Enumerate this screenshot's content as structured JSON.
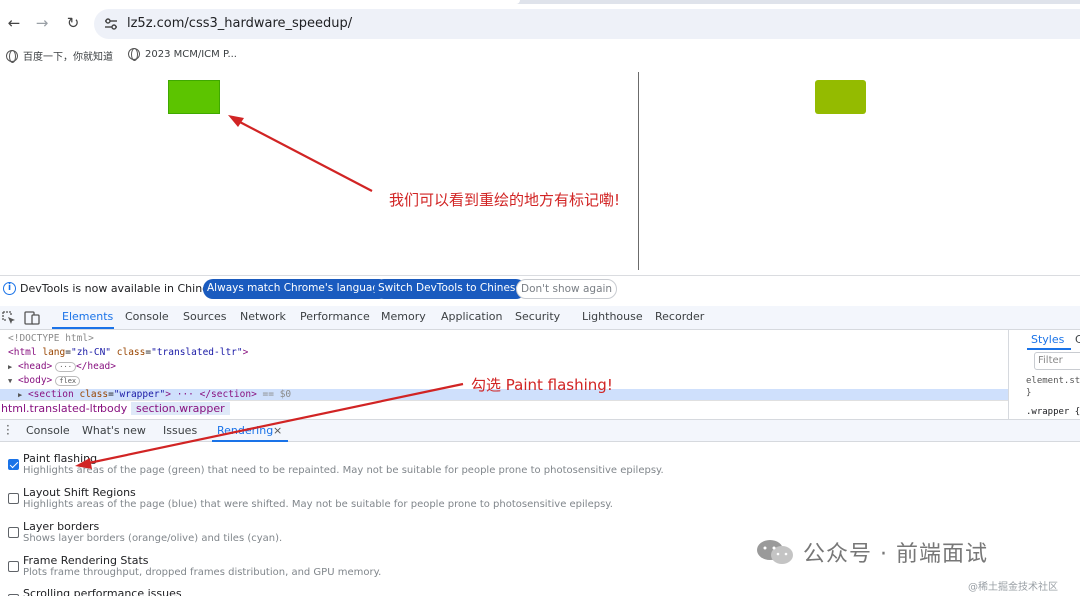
{
  "browser": {
    "url": "lz5z.com/css3_hardware_speedup/",
    "bookmarks": [
      "百度一下，你就知道",
      "2023 MCM/ICM P..."
    ]
  },
  "page": {
    "annotation_main": "我们可以看到重绘的地方有标记嘞!",
    "annotation_paint": "勾选 Paint flashing!"
  },
  "infobar": {
    "message": "DevTools is now available in Chinese!",
    "btn_match": "Always match Chrome's language",
    "btn_switch": "Switch DevTools to Chinese",
    "btn_dismiss": "Don't show again",
    "info_icon": "i"
  },
  "devtools": {
    "tabs": [
      "Elements",
      "Console",
      "Sources",
      "Network",
      "Performance",
      "Memory",
      "Application",
      "Security",
      "Lighthouse",
      "Recorder"
    ],
    "dom": {
      "doctype": "<!DOCTYPE html>",
      "html_open": "<html",
      "html_lang_attr": "lang",
      "html_lang_val": "\"zh-CN\"",
      "html_class_attr": "class",
      "html_class_val": "\"translated-ltr\"",
      "html_close": ">",
      "head": "<head>",
      "head_ellipsis": "···",
      "head_end": "</head>",
      "body": "<body>",
      "body_badge": "flex",
      "section_open": "<section",
      "section_attr": "class",
      "section_val": "\"wrapper\"",
      "section_rest": "> ··· </section>",
      "section_ref": "== $0"
    },
    "breadcrumbs": [
      "html.translated-ltr",
      "body",
      "section.wrapper"
    ],
    "styles": {
      "tab": "Styles",
      "tab2": "C",
      "filter_placeholder": "Filter",
      "rule1": "element.sty",
      "rule1_close": "}",
      "rule2": ".wrapper {"
    }
  },
  "drawer": {
    "tabs": [
      "Console",
      "What's new",
      "Issues",
      "Rendering"
    ],
    "close": "×",
    "options": [
      {
        "title": "Paint flashing",
        "desc": "Highlights areas of the page (green) that need to be repainted. May not be suitable for people prone to photosensitive epilepsy.",
        "checked": true
      },
      {
        "title": "Layout Shift Regions",
        "desc": "Highlights areas of the page (blue) that were shifted. May not be suitable for people prone to photosensitive epilepsy.",
        "checked": false
      },
      {
        "title": "Layer borders",
        "desc": "Shows layer borders (orange/olive) and tiles (cyan).",
        "checked": false
      },
      {
        "title": "Frame Rendering Stats",
        "desc": "Plots frame throughput, dropped frames distribution, and GPU memory.",
        "checked": false
      },
      {
        "title": "Scrolling performance issues",
        "desc": "",
        "checked": false
      }
    ]
  },
  "watermark": {
    "text": "公众号 · 前端面试",
    "small": "@稀土掘金技术社区"
  },
  "colors": {
    "accent": "#1a73e8",
    "annotation": "#d12424",
    "paint_green": "#5cc400",
    "box_olive": "#94bb00"
  }
}
